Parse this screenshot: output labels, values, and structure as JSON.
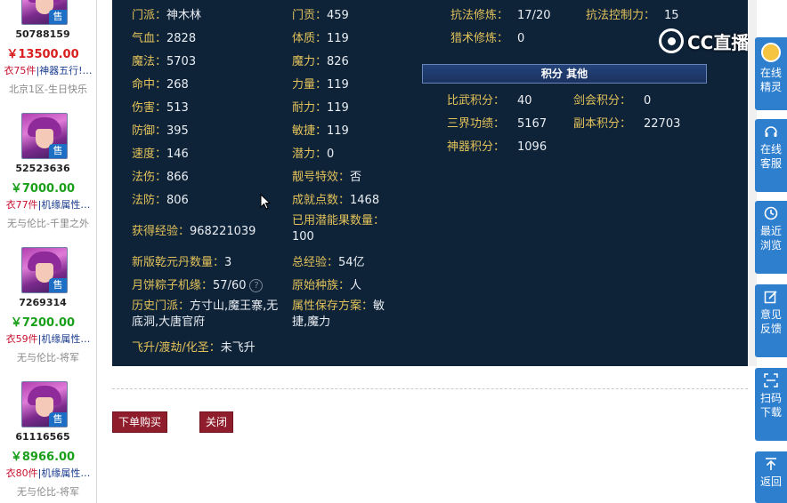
{
  "listings": [
    {
      "id": "50788159",
      "price": "￥13500.00",
      "price_color": "#d81e1e",
      "desc_count": "衣75件",
      "desc_tags": "|神器五行!…",
      "server": "北京1区-生日快乐",
      "badge": "售"
    },
    {
      "id": "52523636",
      "price": "￥7000.00",
      "price_color": "#1aa01a",
      "desc_count": "衣77件",
      "desc_tags": "|机缘属性…",
      "server": "无与伦比-千里之外",
      "badge": "售"
    },
    {
      "id": "7269314",
      "price": "￥7200.00",
      "price_color": "#1aa01a",
      "desc_count": "衣59件",
      "desc_tags": "|机缘属性…",
      "server": "无与伦比-将军",
      "badge": "售"
    },
    {
      "id": "61116565",
      "price": "￥8966.00",
      "price_color": "#1aa01a",
      "desc_count": "衣80件",
      "desc_tags": "|机缘属性…",
      "server": "无与伦比-将军",
      "badge": "售"
    }
  ],
  "stats": {
    "sect": {
      "label": "门派：",
      "value": "神木林"
    },
    "hp": {
      "label": "气血：",
      "value": "2828"
    },
    "mp": {
      "label": "魔法：",
      "value": "5703"
    },
    "hit": {
      "label": "命中：",
      "value": "268"
    },
    "damage": {
      "label": "伤害：",
      "value": "513"
    },
    "defense": {
      "label": "防御：",
      "value": "395"
    },
    "speed": {
      "label": "速度：",
      "value": "146"
    },
    "magic_dmg": {
      "label": "法伤：",
      "value": "866"
    },
    "magic_def": {
      "label": "法防：",
      "value": "806"
    },
    "exp": {
      "label": "获得经验：",
      "value": "968221039"
    },
    "pills": {
      "label": "新版乾元丹数量：",
      "value": "3"
    },
    "mooncake": {
      "label": "月饼粽子机缘：",
      "value": "57/60"
    },
    "history_sect": {
      "label": "历史门派：",
      "value": "方寸山,魔王寨,无底洞,大唐官府"
    },
    "ascension": {
      "label": "飞升/渡劫/化圣：",
      "value": "未飞升"
    },
    "contribution": {
      "label": "门贡：",
      "value": "459"
    },
    "constitution": {
      "label": "体质：",
      "value": "119"
    },
    "magic_power": {
      "label": "魔力：",
      "value": "826"
    },
    "strength": {
      "label": "力量：",
      "value": "119"
    },
    "endurance": {
      "label": "耐力：",
      "value": "119"
    },
    "agility": {
      "label": "敏捷：",
      "value": "119"
    },
    "potential": {
      "label": "潜力：",
      "value": "0"
    },
    "title_effect": {
      "label": "靓号特效：",
      "value": "否"
    },
    "achievement": {
      "label": "成就点数：",
      "value": "1468"
    },
    "potential_fruit": {
      "label": "已用潜能果数量：",
      "value": "100"
    },
    "total_exp": {
      "label": "总经验：",
      "value": "54亿"
    },
    "race": {
      "label": "原始种族：",
      "value": "人"
    },
    "attr_scheme": {
      "label": "属性保存方案：",
      "value": "敏捷,魔力"
    },
    "resist_cultivation": {
      "label": "抗法修炼：",
      "value": "17/20"
    },
    "resist_control": {
      "label": "抗法控制力：",
      "value": "15"
    },
    "hunt_cultivation": {
      "label": "猎术修炼：",
      "value": "0"
    }
  },
  "points": {
    "header": "积分  其他",
    "biwu": {
      "label": "比武积分：",
      "value": "40"
    },
    "jianhui": {
      "label": "剑会积分：",
      "value": "0"
    },
    "sanjie": {
      "label": "三界功绩：",
      "value": "5167"
    },
    "fuben": {
      "label": "副本积分：",
      "value": "22703"
    },
    "shenqi": {
      "label": "神器积分：",
      "value": "1096"
    }
  },
  "help_icon": "?",
  "watermark": "CC直播",
  "actions": {
    "buy": "下单购买",
    "close": "关闭"
  },
  "sidebar": [
    {
      "icon": "avatar-icon",
      "label": "在线精灵"
    },
    {
      "icon": "headset-icon",
      "label": "在线客服"
    },
    {
      "icon": "clock-icon",
      "label": "最近浏览"
    },
    {
      "icon": "edit-icon",
      "label": "意见反馈"
    },
    {
      "icon": "scan-icon",
      "label": "扫码下载"
    },
    {
      "icon": "top-icon",
      "label": "返回"
    }
  ]
}
